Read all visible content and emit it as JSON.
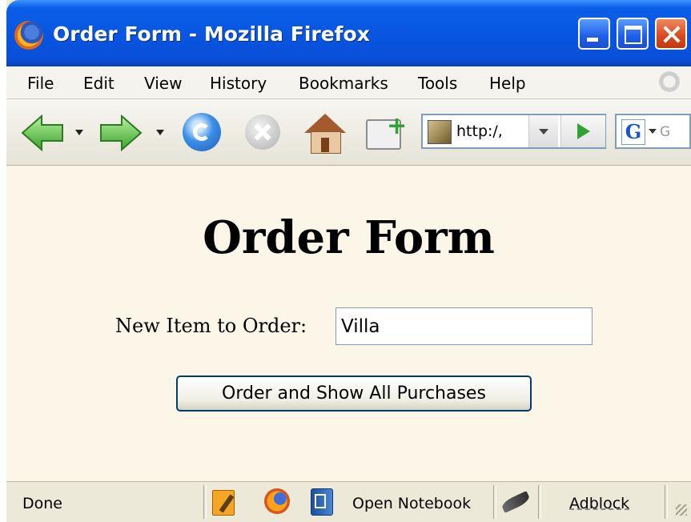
{
  "window": {
    "title": "Order Form - Mozilla Firefox"
  },
  "menubar": {
    "items": [
      {
        "label": "File"
      },
      {
        "label": "Edit"
      },
      {
        "label": "View"
      },
      {
        "label": "History"
      },
      {
        "label": "Bookmarks"
      },
      {
        "label": "Tools"
      },
      {
        "label": "Help"
      }
    ]
  },
  "toolbar": {
    "url": "http:/,",
    "search_placeholder": "G"
  },
  "page": {
    "heading": "Order Form",
    "field_label": "New Item to Order:",
    "field_value": "Villa",
    "submit_label": "Order and Show All Purchases"
  },
  "statusbar": {
    "status": "Done",
    "notebook_label": "Open Notebook",
    "adblock_label": "Adblock"
  }
}
